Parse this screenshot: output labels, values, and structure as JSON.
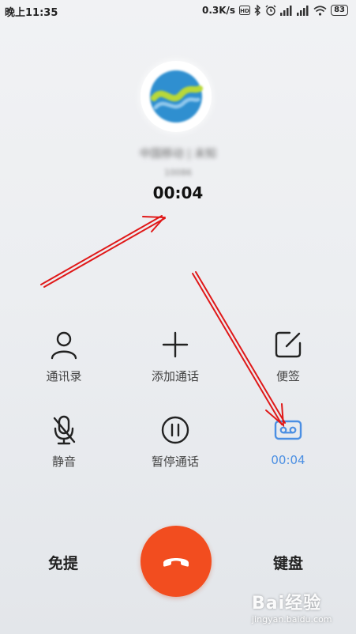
{
  "status_bar": {
    "time": "晚上11:35",
    "net_speed": "0.3K/s",
    "battery": "83",
    "icons": [
      "hd-icon",
      "bluetooth-icon",
      "alarm-icon",
      "signal-icon",
      "signal-icon",
      "wifi-icon",
      "battery-icon"
    ]
  },
  "caller": {
    "name": "中国移动 | 未知",
    "number": "10086",
    "duration": "00:04",
    "avatar_icon": "china-mobile-logo"
  },
  "controls": [
    {
      "label": "通讯录",
      "icon": "contacts-icon"
    },
    {
      "label": "添加通话",
      "icon": "add-call-icon"
    },
    {
      "label": "便签",
      "icon": "note-icon"
    },
    {
      "label": "静音",
      "icon": "mic-off-icon"
    },
    {
      "label": "暂停通话",
      "icon": "pause-icon"
    },
    {
      "label": "00:04",
      "icon": "record-icon",
      "active": true
    }
  ],
  "bottom": {
    "speaker_label": "免提",
    "keypad_label": "键盘",
    "hangup_icon": "hangup-phone-icon"
  },
  "watermark": {
    "logo": "Bai经验",
    "url": "jingyan.baidu.com"
  },
  "colors": {
    "hangup": "#f24d1f",
    "active": "#4b8fe3",
    "annotation_arrow": "#e01818"
  }
}
